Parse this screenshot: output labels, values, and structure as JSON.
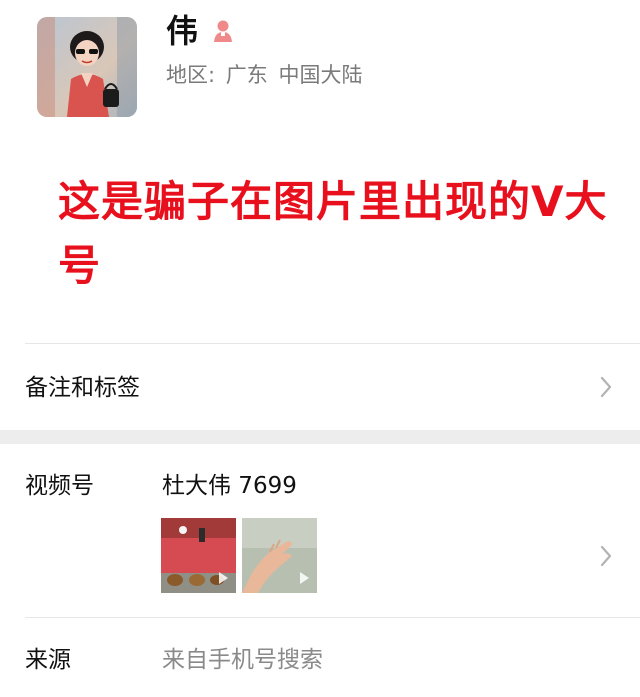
{
  "profile": {
    "name": "伟",
    "gender_icon": "female-user-icon",
    "region_label": "地区:",
    "region_province": "广东",
    "region_country": "中国大陆"
  },
  "annotation": {
    "text": "这是骗子在图片里出现的V大号",
    "color": "#e8101d"
  },
  "remark": {
    "label": "备注和标签"
  },
  "channels": {
    "label": "视频号",
    "name": "杜大伟 7699",
    "thumbnails": [
      "video-thumbnail-ducks",
      "video-thumbnail-hand"
    ]
  },
  "source": {
    "label": "来源",
    "value": "来自手机号搜索"
  },
  "colors": {
    "accent_red": "#e8101d",
    "secondary_text": "#7a7a7a",
    "band_gray": "#ededed",
    "gender_icon": "#f08a8a"
  }
}
